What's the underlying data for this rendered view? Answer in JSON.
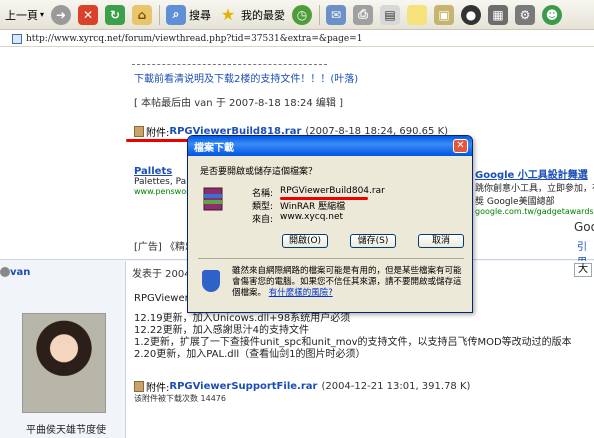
{
  "toolbar": {
    "back_label": "上一頁",
    "search_label": "搜尋",
    "favorites_label": "我的最愛"
  },
  "address": {
    "url": "http://www.xyrcq.net/forum/viewthread.php?tid=37531&extra=&page=1"
  },
  "post1": {
    "download_note": "下載前看清说明及下载2楼的支持文件！！！(叶落)",
    "edit_note": "[ 本帖最后由 van 于 2007-8-18 18:24 编辑 ]",
    "attachment": {
      "prefix": "附件: ",
      "name": "RPGViewerBuild818.rar",
      "meta": "(2007-8-18 18:24, 690.65 K)"
    },
    "ad_left": {
      "title": "Pallets",
      "desc": "Palettes, Palettes,",
      "url": "www.pensword.com"
    },
    "ad_right": {
      "title": "Google 小工具設計舞選",
      "desc": "跳你創意小工具，立即參加，有",
      "desc2": "獎 Google美國總部",
      "url": "google.com.tw/gadgetawards"
    },
    "google_word": "Goo",
    "ad_bar": "[广告] 《精忠报",
    "quote_link": "引用"
  },
  "post2": {
    "author": "van",
    "author_title": "平曲侯天雄节度使",
    "posted_at": "发表于 2004-12",
    "font_btn": "大",
    "lines": [
      "RPGViewer支持",
      "12.19更新，加入Unicows.dll+98系统用户必须",
      "12.22更新，加入感謝思汁4的支持文件",
      "1.2更新，扩展了一下查接件unit_spc和unit_mov的支持文件，以支持吕飞传MOD等改动过的版本",
      "2.20更新，加入PAL.dll（查看仙剑1的图片时必须）"
    ],
    "attachment": {
      "prefix": "附件: ",
      "name": "RPGViewerSupportFile.rar",
      "meta": "(2004-12-21 13:01, 391.78 K)"
    },
    "downloads": "该附件被下载次数 14476"
  },
  "dialog": {
    "title": "檔案下載",
    "question": "是否要開啟或儲存這個檔案？",
    "name_label": "名稱:",
    "name_value": "RPGViewerBuild804.rar",
    "type_label": "類型:",
    "type_value": "WinRAR 壓縮檔",
    "from_label": "來自:",
    "from_value": "www.xycq.net",
    "open_btn": "開啟(O)",
    "save_btn": "儲存(S)",
    "cancel_btn": "取消",
    "warning": "雖然來自網際網路的檔案可能是有用的，但是某些檔案有可能會傷害您的電腦。如果您不信任其來源，請不要開啟或儲存這個檔案。",
    "risk_link": "有什麼樣的風險?"
  },
  "colors": {
    "accent": "#1b4eb6",
    "dialog_title": "#0054e3",
    "highlight": "#ee0000"
  }
}
